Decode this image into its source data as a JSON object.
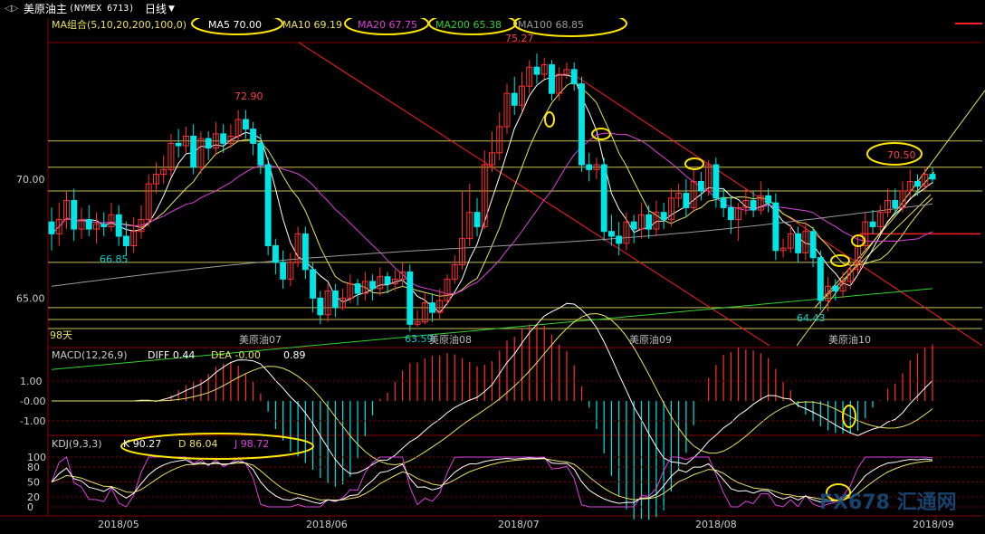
{
  "header": {
    "nav_icon": "arrows-icon",
    "nav_glyph": "◁▷",
    "symbol": "美原油主",
    "exchange": "(NYMEX 6713)",
    "period": "日线",
    "period_icon": "chevron-down-icon"
  },
  "ma_legend": {
    "group": "MA组合(5,10,20,200,100,0)",
    "ma5": "MA5 70.00",
    "ma10": "MA10 69.19",
    "ma20": "MA20 67.75",
    "ma200": "MA200 65.38",
    "ma100": "MA100 68.85",
    "colors": {
      "ma5": "#ffffff",
      "ma10": "#e8e060",
      "ma20": "#e040e0",
      "ma200": "#30d030",
      "ma100": "#9a9a9a"
    }
  },
  "macd_legend": {
    "name": "MACD(12,26,9)",
    "diff": "DIFF 0.44",
    "dea": "DEA -0.00",
    "macd": "0.89"
  },
  "kdj_legend": {
    "name": "KDJ(9,3,3)",
    "k": "K 90.27",
    "d": "D 86.04",
    "j": "J 98.72",
    "colors": {
      "k": "#ffffff",
      "d": "#e8e060",
      "j": "#e040e0"
    }
  },
  "chart_annotations": {
    "high_1": "72.90",
    "high_2": "75.27",
    "high_3": "70.50",
    "low_1": "66.85",
    "low_2": "63.59",
    "low_3": "64.43",
    "days": "98天",
    "contracts": [
      "美原油07",
      "美原油08",
      "美原油09",
      "美原油10"
    ]
  },
  "axis_labels": {
    "price_ticks": [
      "70.00",
      "65.00"
    ],
    "macd_ticks": [
      "1.00",
      "-1.00",
      "-0.00"
    ],
    "kdj_ticks": [
      "100",
      "80",
      "50",
      "20",
      "0"
    ],
    "x_ticks": [
      "2018/05",
      "2018/06",
      "2018/07",
      "2018/08",
      "2018/09"
    ]
  },
  "watermark": "FX678 汇通网",
  "colors": {
    "up": "#ff3030",
    "down": "#00e5e5",
    "grid": "#8a0000",
    "support": "#e8e060",
    "channel": "#ff2020"
  },
  "chart_data": {
    "type": "candlestick",
    "title": "美原油主 (NYMEX 6713) 日线",
    "ylim": [
      63.0,
      76.0
    ],
    "yticks": [
      65.0,
      70.0
    ],
    "horizontal_levels": [
      70.5,
      69.5,
      66.5,
      64.6,
      64.1,
      71.6
    ],
    "candles": [
      [
        68.2,
        67.7,
        68.8,
        67.0
      ],
      [
        67.7,
        68.3,
        69.0,
        67.2
      ],
      [
        68.3,
        69.1,
        69.5,
        67.9
      ],
      [
        69.1,
        67.9,
        69.6,
        67.4
      ],
      [
        67.9,
        68.3,
        68.8,
        67.5
      ],
      [
        68.3,
        67.9,
        68.9,
        67.6
      ],
      [
        67.9,
        68.1,
        68.6,
        67.3
      ],
      [
        68.1,
        68.0,
        68.6,
        67.6
      ],
      [
        68.0,
        68.5,
        69.0,
        67.8
      ],
      [
        68.5,
        67.6,
        68.9,
        67.2
      ],
      [
        67.6,
        67.2,
        68.2,
        66.8
      ],
      [
        67.2,
        67.8,
        68.4,
        66.9
      ],
      [
        67.8,
        68.3,
        68.9,
        67.5
      ],
      [
        68.3,
        69.8,
        70.2,
        68.0
      ],
      [
        69.8,
        70.2,
        70.7,
        69.4
      ],
      [
        70.2,
        70.4,
        71.0,
        69.8
      ],
      [
        70.4,
        71.5,
        71.9,
        70.1
      ],
      [
        71.5,
        71.4,
        72.1,
        70.9
      ],
      [
        71.4,
        71.8,
        72.2,
        71.1
      ],
      [
        71.8,
        70.5,
        72.3,
        70.2
      ],
      [
        70.5,
        71.7,
        72.0,
        70.2
      ],
      [
        71.7,
        71.3,
        72.0,
        70.8
      ],
      [
        71.3,
        71.9,
        72.4,
        71.0
      ],
      [
        71.9,
        71.5,
        72.3,
        71.1
      ],
      [
        71.5,
        71.8,
        72.3,
        71.3
      ],
      [
        71.8,
        72.5,
        72.9,
        71.6
      ],
      [
        72.5,
        72.1,
        72.9,
        71.7
      ],
      [
        72.1,
        71.5,
        72.4,
        71.0
      ],
      [
        71.5,
        70.6,
        71.9,
        70.2
      ],
      [
        70.6,
        67.2,
        70.9,
        66.8
      ],
      [
        67.2,
        66.5,
        67.5,
        66.0
      ],
      [
        66.5,
        65.8,
        67.0,
        65.4
      ],
      [
        65.8,
        66.5,
        66.9,
        65.5
      ],
      [
        66.5,
        67.7,
        68.0,
        66.3
      ],
      [
        67.7,
        66.2,
        68.0,
        65.8
      ],
      [
        66.2,
        65.0,
        66.5,
        64.4
      ],
      [
        65.0,
        64.3,
        65.3,
        63.9
      ],
      [
        64.3,
        65.3,
        65.6,
        64.0
      ],
      [
        65.3,
        64.6,
        65.6,
        64.2
      ],
      [
        64.6,
        65.0,
        65.4,
        64.5
      ],
      [
        65.0,
        65.6,
        66.0,
        64.8
      ],
      [
        65.6,
        65.2,
        65.8,
        64.7
      ],
      [
        65.2,
        65.7,
        66.1,
        64.9
      ],
      [
        65.7,
        65.4,
        66.0,
        64.9
      ],
      [
        65.4,
        65.9,
        66.3,
        65.1
      ],
      [
        65.9,
        65.6,
        66.1,
        65.2
      ],
      [
        65.6,
        65.8,
        66.2,
        65.3
      ],
      [
        65.8,
        66.1,
        66.5,
        65.5
      ],
      [
        66.1,
        63.9,
        66.4,
        63.6
      ],
      [
        63.9,
        64.0,
        64.5,
        63.8
      ],
      [
        64.0,
        64.8,
        65.2,
        63.9
      ],
      [
        64.8,
        64.4,
        65.2,
        64.0
      ],
      [
        64.4,
        64.9,
        65.4,
        64.1
      ],
      [
        64.9,
        65.8,
        66.0,
        64.7
      ],
      [
        65.8,
        66.4,
        66.8,
        65.6
      ],
      [
        66.4,
        67.5,
        69.5,
        66.2
      ],
      [
        67.5,
        68.6,
        69.8,
        67.2
      ],
      [
        68.6,
        68.0,
        69.2,
        67.6
      ],
      [
        68.0,
        70.6,
        71.2,
        67.9
      ],
      [
        70.6,
        71.1,
        72.0,
        70.3
      ],
      [
        71.1,
        72.2,
        72.8,
        70.8
      ],
      [
        72.2,
        73.6,
        74.0,
        71.9
      ],
      [
        73.6,
        73.1,
        74.3,
        72.7
      ],
      [
        73.1,
        73.9,
        74.5,
        72.8
      ],
      [
        73.9,
        74.7,
        75.0,
        73.6
      ],
      [
        74.7,
        74.4,
        75.27,
        74.0
      ],
      [
        74.4,
        74.8,
        75.1,
        74.2
      ],
      [
        74.8,
        73.6,
        75.0,
        73.3
      ],
      [
        73.6,
        74.4,
        74.7,
        73.3
      ],
      [
        74.4,
        74.6,
        74.9,
        74.2
      ],
      [
        74.6,
        74.0,
        74.9,
        73.7
      ],
      [
        74.0,
        70.6,
        74.3,
        70.3
      ],
      [
        70.6,
        70.4,
        71.1,
        69.9
      ],
      [
        70.4,
        70.6,
        70.9,
        70.0
      ],
      [
        70.6,
        67.8,
        70.9,
        67.4
      ],
      [
        67.8,
        67.6,
        68.5,
        67.2
      ],
      [
        67.6,
        67.3,
        68.2,
        66.8
      ],
      [
        67.3,
        68.2,
        68.6,
        67.0
      ],
      [
        68.2,
        67.9,
        68.5,
        67.3
      ],
      [
        67.9,
        68.5,
        69.0,
        67.5
      ],
      [
        68.5,
        67.9,
        68.9,
        67.5
      ],
      [
        67.9,
        68.6,
        69.1,
        67.6
      ],
      [
        68.6,
        68.3,
        69.0,
        67.9
      ],
      [
        68.3,
        69.2,
        69.6,
        68.0
      ],
      [
        69.2,
        69.4,
        69.8,
        68.8
      ],
      [
        69.4,
        68.8,
        70.0,
        68.4
      ],
      [
        68.8,
        69.9,
        70.4,
        68.6
      ],
      [
        69.9,
        69.5,
        70.3,
        69.1
      ],
      [
        69.5,
        70.6,
        70.8,
        69.3
      ],
      [
        70.6,
        69.2,
        70.9,
        68.8
      ],
      [
        69.2,
        68.8,
        69.6,
        68.4
      ],
      [
        68.8,
        68.3,
        69.3,
        67.7
      ],
      [
        68.3,
        68.8,
        69.0,
        67.4
      ],
      [
        68.8,
        69.1,
        69.6,
        68.5
      ],
      [
        69.1,
        68.7,
        69.5,
        68.4
      ],
      [
        68.7,
        69.3,
        69.9,
        68.5
      ],
      [
        69.3,
        69.0,
        69.6,
        68.6
      ],
      [
        69.0,
        67.0,
        69.4,
        66.6
      ],
      [
        67.0,
        67.1,
        67.5,
        66.7
      ],
      [
        67.1,
        67.7,
        68.1,
        66.9
      ],
      [
        67.7,
        66.9,
        68.0,
        66.5
      ],
      [
        66.9,
        67.8,
        68.2,
        66.6
      ],
      [
        67.8,
        66.7,
        68.0,
        66.3
      ],
      [
        66.7,
        64.9,
        67.0,
        64.5
      ],
      [
        64.9,
        65.5,
        65.9,
        64.43
      ],
      [
        65.5,
        65.3,
        65.8,
        64.9
      ],
      [
        65.3,
        65.7,
        66.1,
        65.0
      ],
      [
        65.7,
        66.2,
        66.5,
        65.4
      ],
      [
        66.2,
        67.2,
        67.6,
        66.0
      ],
      [
        67.2,
        68.2,
        68.6,
        67.0
      ],
      [
        68.2,
        68.0,
        68.7,
        67.7
      ],
      [
        68.0,
        68.6,
        68.9,
        67.8
      ],
      [
        68.6,
        69.1,
        69.6,
        68.4
      ],
      [
        69.1,
        68.8,
        69.6,
        68.5
      ],
      [
        68.8,
        69.5,
        69.9,
        68.6
      ],
      [
        69.5,
        69.9,
        70.4,
        69.2
      ],
      [
        69.9,
        69.7,
        70.2,
        69.3
      ],
      [
        69.7,
        70.2,
        70.5,
        69.5
      ],
      [
        70.2,
        70.0,
        70.5,
        69.8
      ]
    ],
    "macd": {
      "diff": 0.44,
      "dea": -0.0,
      "macd": 0.89,
      "yticks": [
        1.0,
        -1.0
      ]
    },
    "kdj": {
      "k": 90.27,
      "d": 86.04,
      "j": 98.72,
      "yticks": [
        100,
        80,
        50,
        20,
        0
      ]
    },
    "x_ticks": [
      "2018/05",
      "2018/06",
      "2018/07",
      "2018/08",
      "2018/09"
    ]
  }
}
